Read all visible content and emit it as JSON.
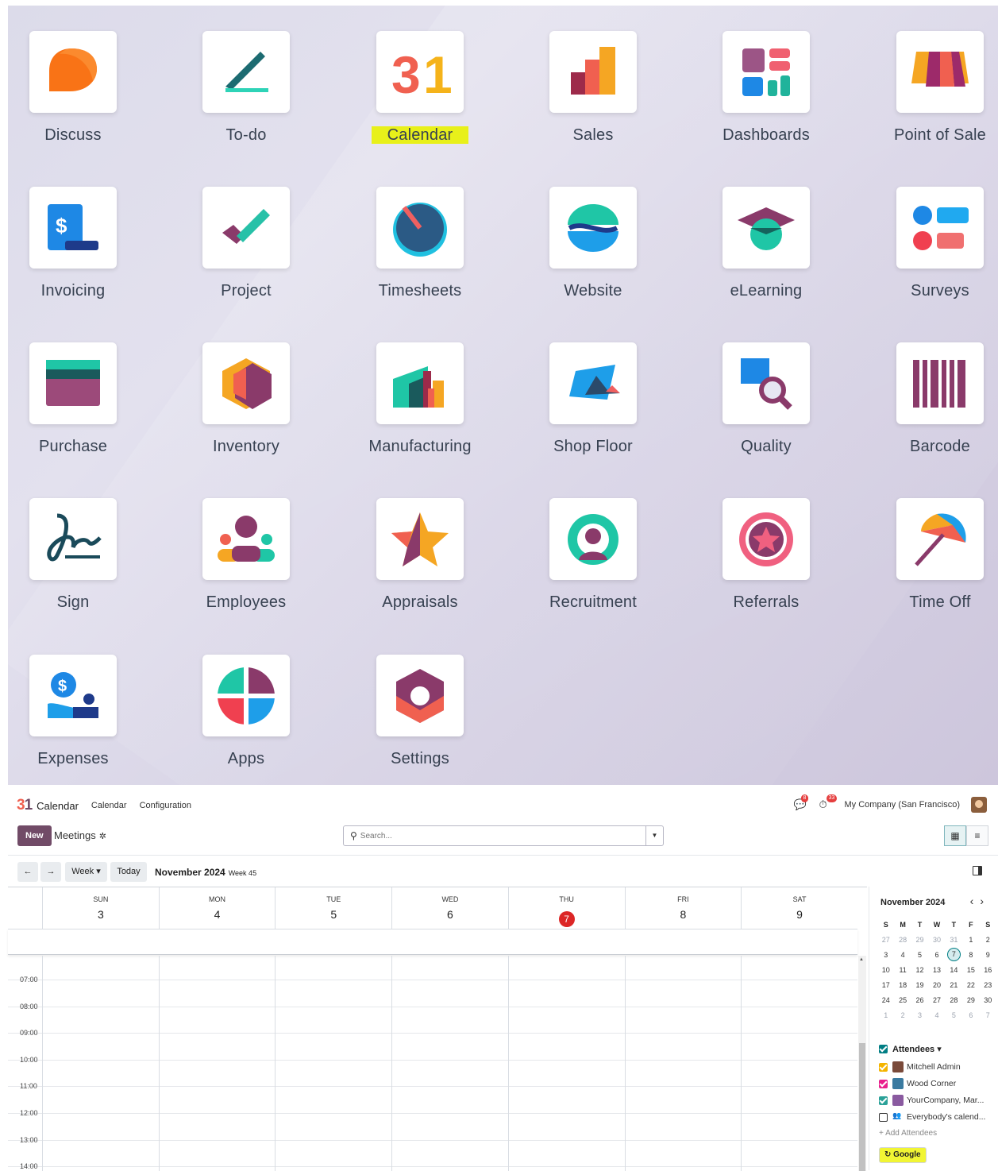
{
  "apps": [
    {
      "label": "Discuss",
      "icon": "discuss-icon"
    },
    {
      "label": "To-do",
      "icon": "todo-icon"
    },
    {
      "label": "Calendar",
      "icon": "calendar-icon",
      "highlighted": true
    },
    {
      "label": "Sales",
      "icon": "sales-icon"
    },
    {
      "label": "Dashboards",
      "icon": "dashboards-icon"
    },
    {
      "label": "Point of Sale",
      "icon": "point-of-sale-icon"
    },
    {
      "label": "Invoicing",
      "icon": "invoicing-icon"
    },
    {
      "label": "Project",
      "icon": "project-icon"
    },
    {
      "label": "Timesheets",
      "icon": "timesheets-icon"
    },
    {
      "label": "Website",
      "icon": "website-icon"
    },
    {
      "label": "eLearning",
      "icon": "elearning-icon"
    },
    {
      "label": "Surveys",
      "icon": "surveys-icon"
    },
    {
      "label": "Purchase",
      "icon": "purchase-icon"
    },
    {
      "label": "Inventory",
      "icon": "inventory-icon"
    },
    {
      "label": "Manufacturing",
      "icon": "manufacturing-icon"
    },
    {
      "label": "Shop Floor",
      "icon": "shop-floor-icon"
    },
    {
      "label": "Quality",
      "icon": "quality-icon"
    },
    {
      "label": "Barcode",
      "icon": "barcode-icon"
    },
    {
      "label": "Sign",
      "icon": "sign-icon"
    },
    {
      "label": "Employees",
      "icon": "employees-icon"
    },
    {
      "label": "Appraisals",
      "icon": "appraisals-icon"
    },
    {
      "label": "Recruitment",
      "icon": "recruitment-icon"
    },
    {
      "label": "Referrals",
      "icon": "referrals-icon"
    },
    {
      "label": "Time Off",
      "icon": "time-off-icon"
    },
    {
      "label": "Expenses",
      "icon": "expenses-icon"
    },
    {
      "label": "Apps",
      "icon": "apps-icon"
    },
    {
      "label": "Settings",
      "icon": "settings-icon"
    }
  ],
  "highlight_color": "#e8f01a",
  "calendar": {
    "navbar": {
      "app_name": "Calendar",
      "menu": [
        "Calendar",
        "Configuration"
      ],
      "messages_count": "8",
      "activities_count": "33",
      "company": "My Company (San Francisco)"
    },
    "control": {
      "new_label": "New",
      "breadcrumb": "Meetings",
      "search_placeholder": "Search..."
    },
    "datebar": {
      "week_label": "Week",
      "today_label": "Today",
      "range": "November 2024",
      "week_no": "Week 45"
    },
    "days": [
      {
        "name": "SUN",
        "num": "3"
      },
      {
        "name": "MON",
        "num": "4"
      },
      {
        "name": "TUE",
        "num": "5"
      },
      {
        "name": "WED",
        "num": "6"
      },
      {
        "name": "THU",
        "num": "7",
        "today": true
      },
      {
        "name": "FRI",
        "num": "8"
      },
      {
        "name": "SAT",
        "num": "9"
      }
    ],
    "hours": [
      "07:00",
      "08:00",
      "09:00",
      "10:00",
      "11:00",
      "12:00",
      "13:00",
      "14:00"
    ],
    "mini": {
      "title": "November 2024",
      "weekdays": [
        "S",
        "M",
        "T",
        "W",
        "T",
        "F",
        "S"
      ],
      "weeks": [
        [
          "27",
          "28",
          "29",
          "30",
          "31",
          "1",
          "2"
        ],
        [
          "3",
          "4",
          "5",
          "6",
          "7",
          "8",
          "9"
        ],
        [
          "10",
          "11",
          "12",
          "13",
          "14",
          "15",
          "16"
        ],
        [
          "17",
          "18",
          "19",
          "20",
          "21",
          "22",
          "23"
        ],
        [
          "24",
          "25",
          "26",
          "27",
          "28",
          "29",
          "30"
        ],
        [
          "1",
          "2",
          "3",
          "4",
          "5",
          "6",
          "7"
        ]
      ],
      "selected": "7"
    },
    "attendees": {
      "title": "Attendees",
      "items": [
        {
          "name": "Mitchell Admin",
          "color": "#f4b400",
          "checked": true
        },
        {
          "name": "Wood Corner",
          "color": "#e91e8c",
          "checked": true
        },
        {
          "name": "YourCompany, Mar...",
          "color": "#2aa198",
          "checked": true
        },
        {
          "name": "Everybody's calend...",
          "color": "#ffffff",
          "checked": false
        }
      ],
      "add_label": "+ Add Attendees",
      "google_label": "Google"
    }
  }
}
